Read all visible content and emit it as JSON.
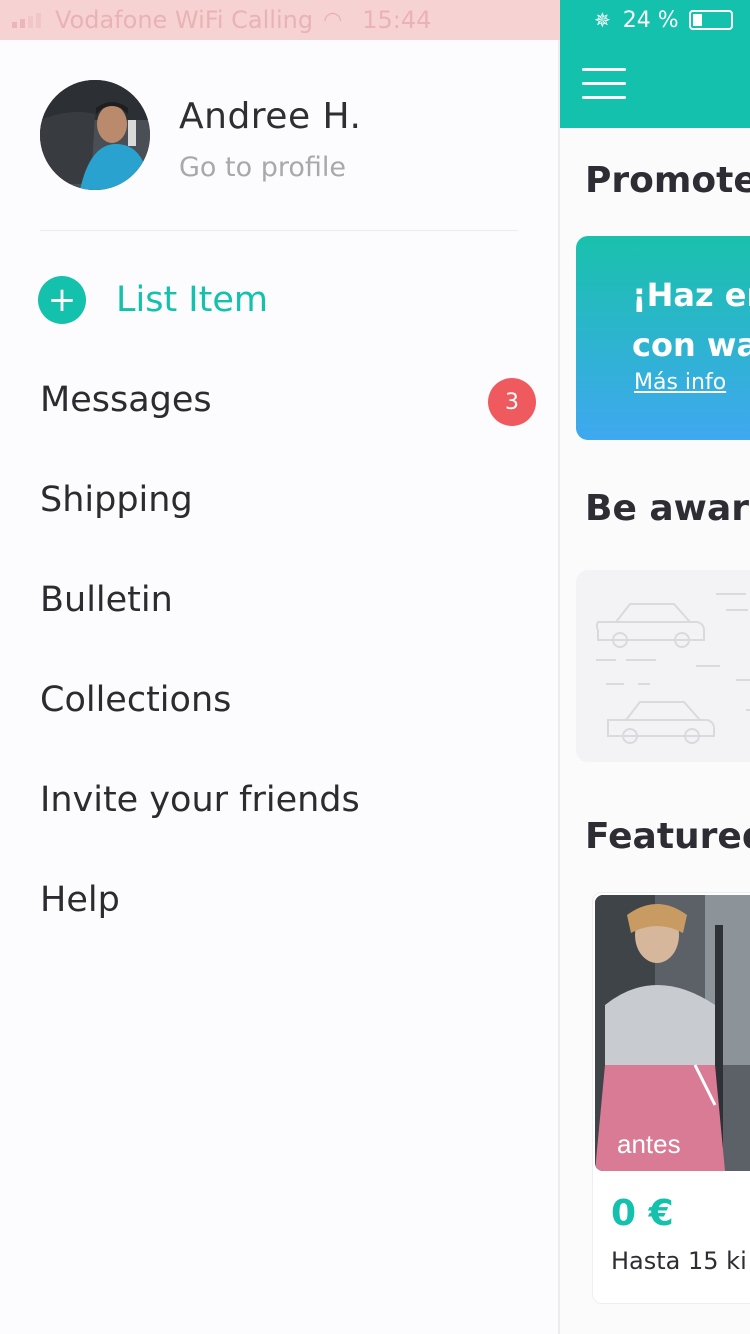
{
  "status_bar": {
    "carrier": "Vodafone WiFi Calling",
    "time": "15:44",
    "battery": "24 %"
  },
  "drawer": {
    "profile": {
      "name": "Andree H.",
      "link": "Go to profile"
    },
    "menu": [
      {
        "label": "List Item",
        "icon": "plus-icon"
      },
      {
        "label": "Messages",
        "badge": "3"
      },
      {
        "label": "Shipping"
      },
      {
        "label": "Bulletin"
      },
      {
        "label": "Collections"
      },
      {
        "label": "Invite your friends"
      },
      {
        "label": "Help"
      }
    ]
  },
  "main": {
    "sections": {
      "promoted": "Promote",
      "aware": "Be aware",
      "featured": "Featured"
    },
    "promo": {
      "line1": "¡Haz en",
      "line2": "con wa",
      "link": "Más info"
    },
    "featured_item": {
      "image_caption": "antes",
      "price": "0 €",
      "description": "Hasta 15 ki"
    }
  },
  "colors": {
    "accent": "#13c1ac",
    "badge": "#ef5a5f",
    "status_bar_left": "#f7d2d3"
  }
}
